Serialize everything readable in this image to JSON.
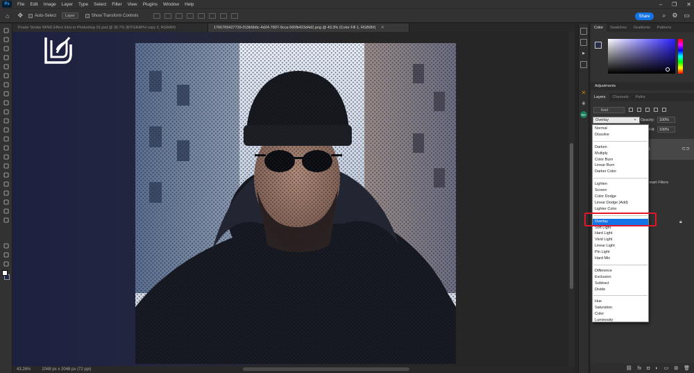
{
  "app": {
    "logo_text": "Ps"
  },
  "menu": [
    "File",
    "Edit",
    "Image",
    "Layer",
    "Type",
    "Select",
    "Filter",
    "View",
    "Plugins",
    "Window",
    "Help"
  ],
  "options_bar": {
    "auto_select_label": "Auto-Select",
    "layer_target": "Layer",
    "show_transform_label": "Show Transform Controls",
    "share_label": "Share"
  },
  "tabs": [
    {
      "label": "Poster Stroke WIND Effect Intro in Photoshop 01.psd @ 36.7% (BITGRAPH copy 3, RGB/8#)",
      "active": false
    },
    {
      "label": "1766765427739-019b5b6c-4d24-7807-9cca-560fb423d4d2.png @ 43.3% (Color Fill 1, RGB/8#)",
      "active": true
    }
  ],
  "status": {
    "zoom": "43.26%",
    "doc_info": "2048 px x 2048 px (72 ppi)"
  },
  "panels": {
    "color_tabs": [
      "Color",
      "Swatches",
      "Gradients",
      "Patterns"
    ],
    "adjustments_label": "Adjustments",
    "layers_tabs": [
      "Layers",
      "Channels",
      "Paths"
    ],
    "kind_label": "Kind",
    "blend_mode": "Overlay",
    "opacity_label": "Opacity:",
    "opacity_value": "100%",
    "fill_label": "Fill:",
    "fill_value": "100%",
    "smart_filters_label": "Smart Filters",
    "layer_num": "1"
  },
  "blend_modes": [
    [
      "Normal",
      "Dissolve"
    ],
    [
      "Darken",
      "Multiply",
      "Color Burn",
      "Linear Burn",
      "Darker Color"
    ],
    [
      "Lighten",
      "Screen",
      "Color Dodge",
      "Linear Dodge (Add)",
      "Lighter Color"
    ],
    [
      "Overlay",
      "Soft Light",
      "Hard Light",
      "Vivid Light",
      "Linear Light",
      "Pin Light",
      "Hard Mix"
    ],
    [
      "Difference",
      "Exclusion",
      "Subtract",
      "Divide"
    ],
    [
      "Hue",
      "Saturation",
      "Color",
      "Luminosity"
    ]
  ],
  "selected_blend_mode": "Overlay",
  "colors": {
    "accent": "#1473e6",
    "highlight": "#e3152b",
    "foreground": "#2a2f45",
    "background": "#ffffff"
  },
  "icons": [
    "home-icon",
    "move-tool-icon",
    "search-icon",
    "gear-icon",
    "minimize-icon",
    "maximize-icon",
    "close-icon"
  ]
}
